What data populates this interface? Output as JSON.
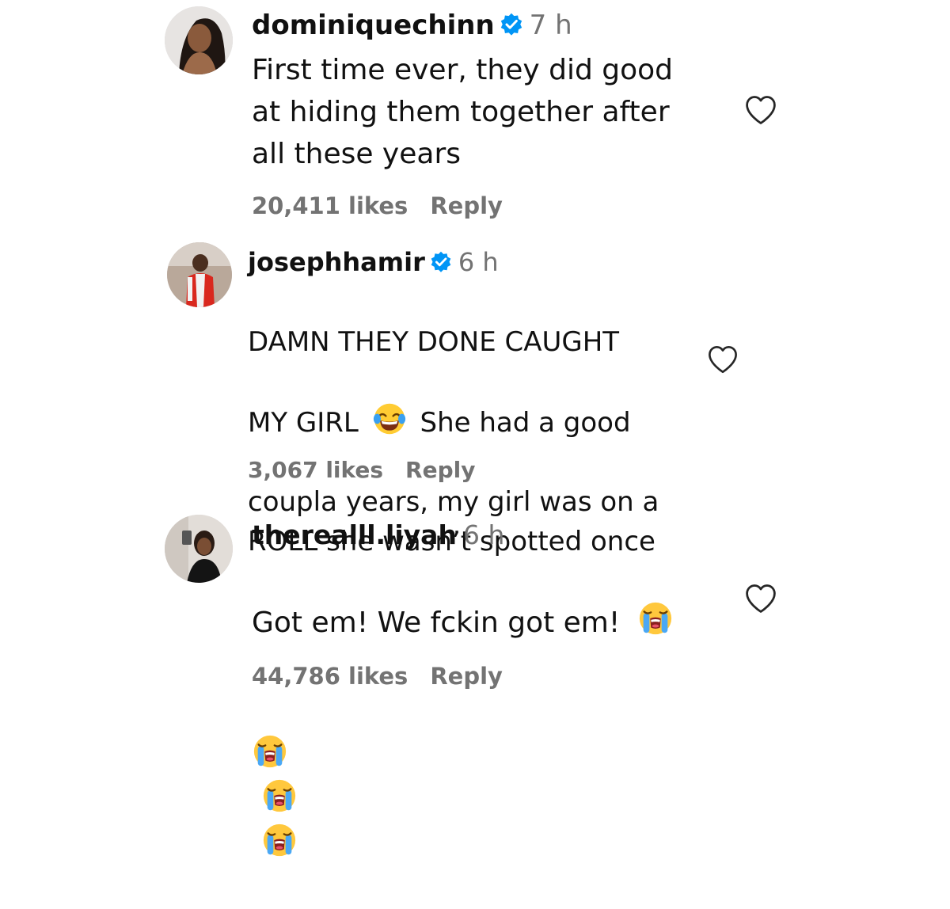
{
  "comments": [
    {
      "username": "dominiquechinn",
      "verified": true,
      "time": "7 h",
      "text": "First time ever, they did good\nat hiding them together after\nall these years",
      "likes": "20,411 likes",
      "reply": "Reply"
    },
    {
      "username": "josephhamir",
      "verified": true,
      "time": "6 h",
      "text_line1": "DAMN THEY DONE CAUGHT",
      "text_line2_a": "MY GIRL",
      "text_line2_b": "She had a good",
      "text_rest": "coupla years, my girl was on a\nROLL she wasn’t spotted once",
      "likes": "3,067 likes",
      "reply": "Reply"
    },
    {
      "username": "therealll.liyah",
      "verified": false,
      "time": "6 h",
      "text": "Got em! We fckin got em!",
      "likes": "44,786 likes",
      "reply": "Reply"
    }
  ],
  "icons": {
    "verified": "verified-badge-icon",
    "heart": "heart-outline-icon",
    "emoji_laugh": "face-with-tears-of-joy-emoji",
    "emoji_cry": "loudly-crying-face-emoji"
  },
  "colors": {
    "verified_blue": "#0095f6",
    "muted": "#737373"
  }
}
